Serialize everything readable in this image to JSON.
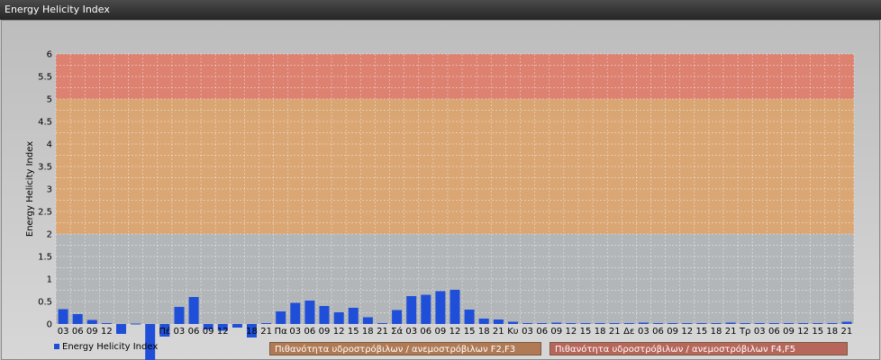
{
  "window": {
    "title": "Energy Helicity Index"
  },
  "legend": {
    "series_label": "Energy Helicity Index"
  },
  "bands": [
    {
      "label": "Πιθανότητα υδροστρόβιλων / ανεμοστρόβιλων F2,F3",
      "from": 2,
      "to": 5,
      "color": "#dba26a"
    },
    {
      "label": "Πιθανότητα υδροστρόβιλων / ανεμοστρόβιλων F4,F5",
      "from": 5,
      "to": 6,
      "color": "#e07a68"
    }
  ],
  "chart_data": {
    "type": "bar",
    "ylabel": "Energy Helicity Index",
    "ylim": [
      0,
      6
    ],
    "yticks": [
      "0",
      "0.5",
      "1",
      "1.5",
      "2",
      "2.5",
      "3",
      "3.5",
      "4",
      "4.5",
      "5",
      "5.5",
      "6"
    ],
    "grid": true,
    "legend_position": "bottom-left",
    "categories": [
      "03",
      "06",
      "09",
      "12",
      "15",
      "18",
      "21",
      "Πέ",
      "03",
      "06",
      "09",
      "12",
      "15",
      "18",
      "21",
      "Πα",
      "03",
      "06",
      "09",
      "12",
      "15",
      "18",
      "21",
      "Σά",
      "03",
      "06",
      "09",
      "12",
      "15",
      "18",
      "21",
      "Κυ",
      "03",
      "06",
      "09",
      "12",
      "15",
      "18",
      "21",
      "Δε",
      "03",
      "06",
      "09",
      "12",
      "15",
      "18",
      "21",
      "Τρ",
      "03",
      "06",
      "09",
      "12",
      "15",
      "18",
      "21"
    ],
    "tick_labels": [
      "03",
      "06",
      "09",
      "12",
      "",
      "",
      "",
      "Πέ",
      "03",
      "06",
      "09",
      "12",
      "",
      "18",
      "21",
      "Πα",
      "03",
      "06",
      "09",
      "12",
      "15",
      "18",
      "21",
      "Σά",
      "03",
      "06",
      "09",
      "12",
      "15",
      "18",
      "21",
      "Κυ",
      "03",
      "06",
      "09",
      "12",
      "15",
      "18",
      "21",
      "Δε",
      "03",
      "06",
      "09",
      "12",
      "15",
      "18",
      "21",
      "Τρ",
      "03",
      "06",
      "09",
      "12",
      "15",
      "18",
      "21"
    ],
    "series": [
      {
        "name": "Energy Helicity Index",
        "color": "#1f4fd8",
        "values": [
          0.33,
          0.22,
          0.09,
          0.02,
          -0.22,
          0.01,
          -0.8,
          -0.28,
          0.38,
          0.6,
          -0.12,
          -0.15,
          -0.08,
          -0.3,
          0.02,
          0.28,
          0.47,
          0.52,
          0.4,
          0.26,
          0.36,
          0.15,
          0.02,
          0.31,
          0.62,
          0.65,
          0.73,
          0.76,
          0.32,
          0.12,
          0.1,
          0.05,
          0.02,
          0.02,
          0.03,
          0.02,
          0.02,
          0.02,
          0.02,
          0.02,
          0.03,
          0.02,
          0.02,
          0.02,
          0.02,
          0.02,
          0.03,
          0.02,
          0.02,
          0.02,
          0.02,
          0.02,
          0.02,
          0.02,
          0.05
        ]
      }
    ]
  }
}
